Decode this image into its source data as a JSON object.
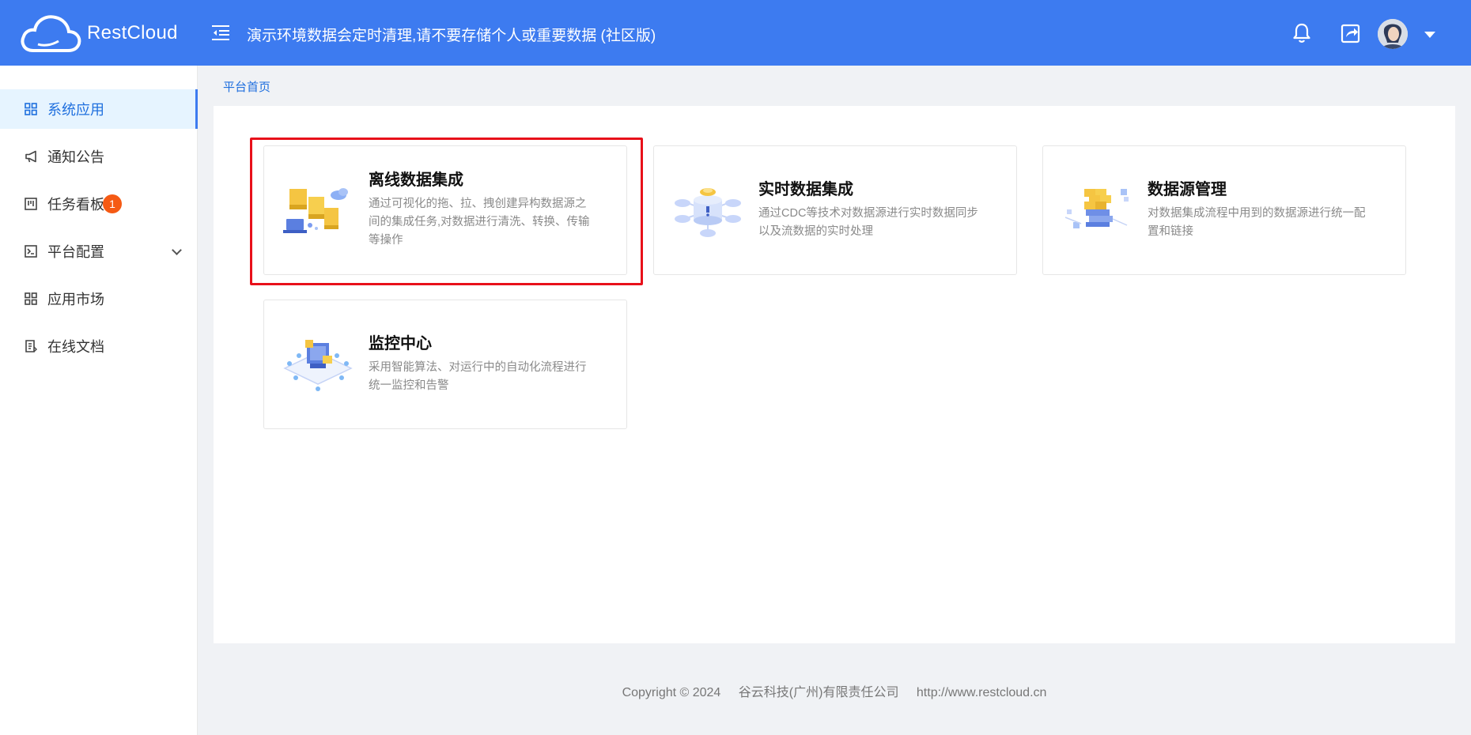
{
  "header": {
    "logo_text": "RestCloud",
    "notice": "演示环境数据会定时清理,请不要存储个人或重要数据 (社区版)",
    "icons": [
      "bell-icon",
      "share-icon",
      "avatar",
      "caret-down-icon"
    ],
    "background": "#3d7bf0"
  },
  "sidebar": {
    "items": [
      {
        "label": "系统应用",
        "icon": "grid-icon",
        "active": true
      },
      {
        "label": "通知公告",
        "icon": "megaphone-icon"
      },
      {
        "label": "任务看板",
        "icon": "kanban-icon",
        "badge": "1"
      },
      {
        "label": "平台配置",
        "icon": "terminal-icon",
        "expandable": true
      },
      {
        "label": "应用市场",
        "icon": "grid-icon"
      },
      {
        "label": "在线文档",
        "icon": "document-icon"
      }
    ]
  },
  "breadcrumb": "平台首页",
  "cards": [
    {
      "title": "离线数据集成",
      "desc": "通过可视化的拖、拉、拽创建异构数据源之间的集成任务,对数据进行清洗、转换、传输等操作",
      "highlighted": true
    },
    {
      "title": "实时数据集成",
      "desc": "通过CDC等技术对数据源进行实时数据同步以及流数据的实时处理"
    },
    {
      "title": "数据源管理",
      "desc": "对数据集成流程中用到的数据源进行统一配置和链接"
    },
    {
      "title": "监控中心",
      "desc": "采用智能算法、对运行中的自动化流程进行统一监控和告警"
    }
  ],
  "footer": {
    "copyright": "Copyright © 2024",
    "company": "谷云科技(广州)有限责任公司",
    "url": "http://www.restcloud.cn"
  }
}
